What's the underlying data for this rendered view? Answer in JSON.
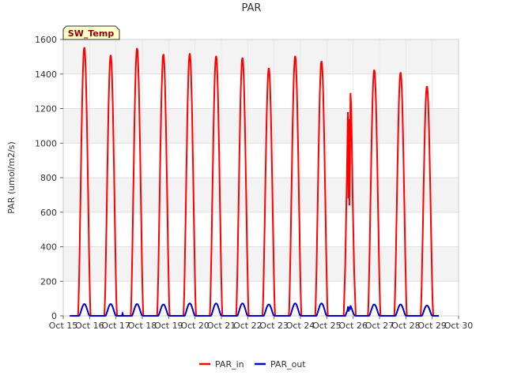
{
  "chart_data": {
    "type": "line",
    "title": "PAR",
    "xlabel": "",
    "ylabel": "PAR (umol/m2/s)",
    "xlim": [
      15,
      30
    ],
    "ylim": [
      0,
      1600
    ],
    "x_ticks": [
      15,
      16,
      17,
      18,
      19,
      20,
      21,
      22,
      23,
      24,
      25,
      26,
      27,
      28,
      29,
      30
    ],
    "x_tick_labels": [
      "Oct 15",
      "Oct 16",
      "Oct 17",
      "Oct 18",
      "Oct 19",
      "Oct 20",
      "Oct 21",
      "Oct 22",
      "Oct 23",
      "Oct 24",
      "Oct 25",
      "Oct 26",
      "Oct 27",
      "Oct 28",
      "Oct 29",
      "Oct 30"
    ],
    "y_ticks": [
      0,
      200,
      400,
      600,
      800,
      1000,
      1200,
      1400,
      1600
    ],
    "y_tick_labels": [
      "0",
      "200",
      "400",
      "600",
      "800",
      "1000",
      "1200",
      "1400",
      "1600"
    ],
    "grid": true,
    "background_bands": true,
    "legend_position": "bottom-center",
    "annotation": "SW_Temp",
    "series": [
      {
        "name": "PAR_in",
        "color": "#ff0000",
        "daily_peaks": [
          {
            "day": "Oct 16",
            "x": 15.8,
            "peak": 1555
          },
          {
            "day": "Oct 17",
            "x": 16.8,
            "peak": 1510
          },
          {
            "day": "Oct 18",
            "x": 17.8,
            "peak": 1550
          },
          {
            "day": "Oct 19",
            "x": 18.8,
            "peak": 1515
          },
          {
            "day": "Oct 20",
            "x": 19.8,
            "peak": 1520
          },
          {
            "day": "Oct 21",
            "x": 20.8,
            "peak": 1505
          },
          {
            "day": "Oct 22",
            "x": 21.8,
            "peak": 1495
          },
          {
            "day": "Oct 23",
            "x": 22.8,
            "peak": 1435
          },
          {
            "day": "Oct 24",
            "x": 23.8,
            "peak": 1505
          },
          {
            "day": "Oct 25",
            "x": 24.8,
            "peak": 1475
          },
          {
            "day": "Oct 26",
            "x": 25.9,
            "peak": 1290,
            "note": "irregular, dips to about 640"
          },
          {
            "day": "Oct 27",
            "x": 26.8,
            "peak": 1425
          },
          {
            "day": "Oct 28",
            "x": 27.8,
            "peak": 1410
          },
          {
            "day": "Oct 29",
            "x": 28.8,
            "peak": 1330
          }
        ]
      },
      {
        "name": "PAR_out",
        "color": "#0000cc",
        "daily_peaks": [
          {
            "day": "Oct 16",
            "x": 15.8,
            "peak": 68
          },
          {
            "day": "Oct 17",
            "x": 16.8,
            "peak": 68
          },
          {
            "day": "Oct 18",
            "x": 17.8,
            "peak": 68
          },
          {
            "day": "Oct 19",
            "x": 18.8,
            "peak": 66
          },
          {
            "day": "Oct 20",
            "x": 19.8,
            "peak": 72
          },
          {
            "day": "Oct 21",
            "x": 20.8,
            "peak": 72
          },
          {
            "day": "Oct 22",
            "x": 21.8,
            "peak": 72
          },
          {
            "day": "Oct 23",
            "x": 22.8,
            "peak": 66
          },
          {
            "day": "Oct 24",
            "x": 23.8,
            "peak": 72
          },
          {
            "day": "Oct 25",
            "x": 24.8,
            "peak": 72
          },
          {
            "day": "Oct 26",
            "x": 25.9,
            "peak": 60
          },
          {
            "day": "Oct 27",
            "x": 26.8,
            "peak": 66
          },
          {
            "day": "Oct 28",
            "x": 27.8,
            "peak": 66
          },
          {
            "day": "Oct 29",
            "x": 28.8,
            "peak": 60
          }
        ]
      }
    ]
  }
}
